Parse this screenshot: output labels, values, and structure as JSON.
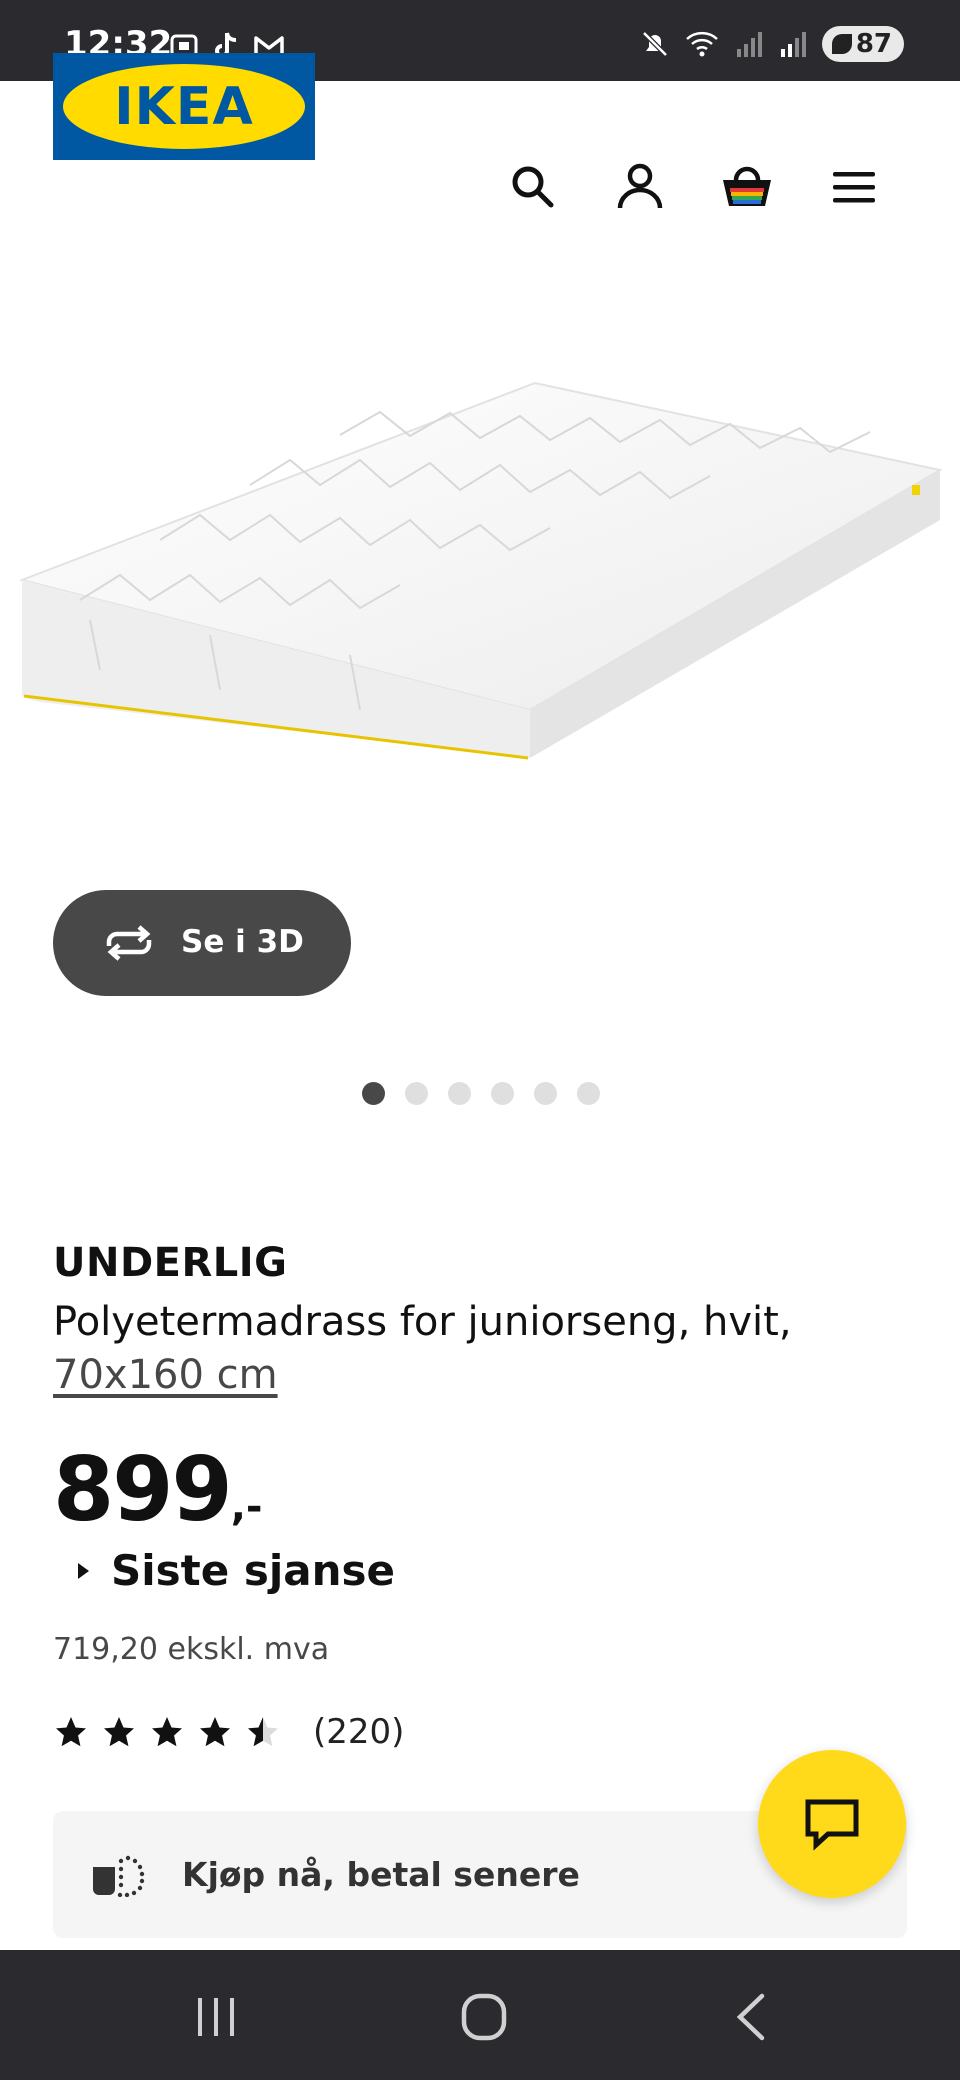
{
  "status_bar": {
    "time": "12:32",
    "battery": "87"
  },
  "header": {
    "logo_text": "IKEA",
    "icons": [
      "search-icon",
      "account-icon",
      "basket-icon",
      "menu-icon"
    ]
  },
  "gallery": {
    "view_3d_label": "Se i 3D",
    "image_count": 6,
    "active_index": 0
  },
  "product": {
    "brand": "UNDERLIG",
    "description": "Polyetermadrass for juniorseng, hvit,",
    "size": "70x160 cm",
    "price": "899",
    "price_suffix": ",-",
    "last_chance_label": "Siste sjanse",
    "ex_vat": "719,20 ekskl. mva",
    "rating": {
      "value": 4.5,
      "max": 5,
      "count": "(220)"
    }
  },
  "pay_later": {
    "label": "Kjøp nå, betal senere"
  },
  "colors": {
    "ikea_blue": "#0058a3",
    "ikea_yellow": "#ffdb00",
    "chat_yellow": "#ffda1a",
    "dark_pill": "#484848",
    "system_bar": "#2b2b2f"
  }
}
